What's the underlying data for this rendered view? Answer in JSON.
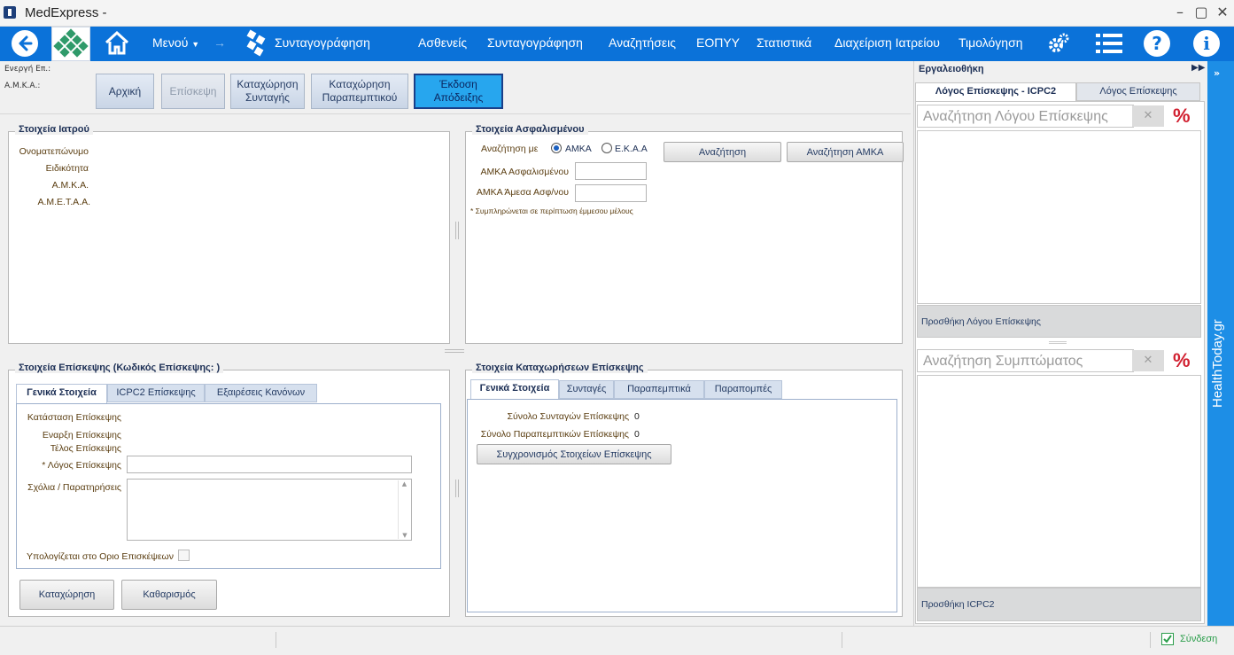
{
  "window": {
    "title": "MedExpress -"
  },
  "menubar": {
    "menu_label": "Μενού",
    "prescribe_label": "Συνταγογράφηση",
    "items": [
      "Ασθενείς",
      "Συνταγογράφηση",
      "Αναζητήσεις",
      "ΕΟΠΥΥ",
      "Στατιστικά",
      "Διαχείριση Ιατρείου",
      "Τιμολόγηση"
    ]
  },
  "infobar": {
    "active_label": "Ενεργή Επ.:",
    "amka_label": "Α.Μ.Κ.Α.:"
  },
  "toolbar": {
    "home": "Αρχική",
    "visit": "Επίσκεψη",
    "register_rx_1": "Καταχώρηση",
    "register_rx_2": "Συνταγής",
    "register_ref_1": "Καταχώρηση",
    "register_ref_2": "Παραπεμπτικού",
    "receipt_1": "Έκδοση",
    "receipt_2": "Απόδειξης"
  },
  "doctor": {
    "title": "Στοιχεία Ιατρού",
    "fields": [
      "Ονοματεπώνυμο",
      "Ειδικότητα",
      "Α.Μ.Κ.Α.",
      "Α.Μ.Ε.Τ.Α.Α."
    ]
  },
  "insured": {
    "title": "Στοιχεία Ασφαλισμένου",
    "search_by": "Αναζήτηση με",
    "opt_amka": "ΑΜΚΑ",
    "opt_ekaa": "Ε.Κ.Α.Α",
    "amka_label": "ΑΜΚΑ Ασφαλισμένου",
    "indirect_label": "ΑΜΚΑ Άμεσα Ασφ/νου",
    "note": "* Συμπληρώνεται σε περίπτωση έμμεσου μέλους",
    "search_btn": "Αναζήτηση",
    "search_amka_btn": "Αναζήτηση ΑΜΚΑ"
  },
  "visit": {
    "title": "Στοιχεία Επίσκεψης (Κωδικός Επίσκεψης: )",
    "tabs": [
      "Γενικά Στοιχεία",
      "ICPC2 Επίσκεψης",
      "Εξαιρέσεις Κανόνων"
    ],
    "status": "Κατάσταση Επίσκεψης",
    "start": "Εναρξη Επίσκεψης",
    "end": "Τέλος Επίσκεψης",
    "reason": "* Λόγος Επίσκεψης",
    "comments": "Σχόλια / Παρατηρήσεις",
    "limit": "Υπολογίζεται στο Οριο Επισκέψεων",
    "save_btn": "Καταχώρηση",
    "clear_btn": "Καθαρισμός"
  },
  "entries": {
    "title": "Στοιχεία Καταχωρήσεων Επίσκεψης",
    "tabs": [
      "Γενικά Στοιχεία",
      "Συνταγές",
      "Παραπεμπτικά",
      "Παραπομπές"
    ],
    "rx_total_label": "Σύνολο Συνταγών Επίσκεψης",
    "rx_total": "0",
    "ref_total_label": "Σύνολο Παραπεμπτικών Επίσκεψης",
    "ref_total": "0",
    "sync_btn": "Συγχρονισμός Στοιχείων Επίσκεψης"
  },
  "toolbox": {
    "title": "Εργαλειοθήκη",
    "tabs": [
      "Λόγος Επίσκεψης - ICPC2",
      "Λόγος Επίσκεψης"
    ],
    "search_reason_placeholder": "Αναζήτηση Λόγου Επίσκεψης",
    "add_reason": "Προσθήκη Λόγου Επίσκεψης",
    "search_symptom_placeholder": "Αναζήτηση Συμπτώματος",
    "add_icpc2": "Προσθήκη ICPC2",
    "percent": "%",
    "clear": "✕"
  },
  "side": {
    "brand": "HealthToday.gr"
  },
  "status": {
    "connect": "Σύνδεση"
  },
  "colors": {
    "menubar": "#0b72d9",
    "accent": "#27a6ee",
    "sidebar": "#1d8ee6",
    "percent": "#d12030"
  }
}
